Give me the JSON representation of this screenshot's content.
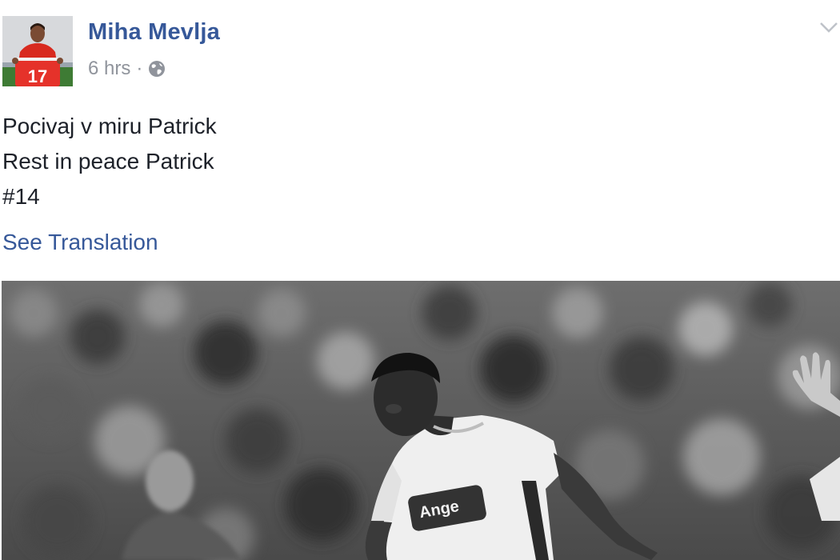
{
  "post": {
    "author_name": "Miha Mevlja",
    "timestamp": "6 hrs",
    "separator": "·",
    "privacy_icon": "globe-icon",
    "menu_icon": "chevron-down-icon",
    "avatar_jersey_number": "17",
    "message_lines": [
      "Pocivaj v miru Patrick",
      "Rest in peace Patrick",
      "#14"
    ],
    "see_translation": "See Translation",
    "photo": {
      "description_icon": "player-photo",
      "jersey_sponsor": "Ange"
    }
  },
  "colors": {
    "link": "#365899",
    "text": "#1d2129",
    "meta": "#90949c"
  }
}
